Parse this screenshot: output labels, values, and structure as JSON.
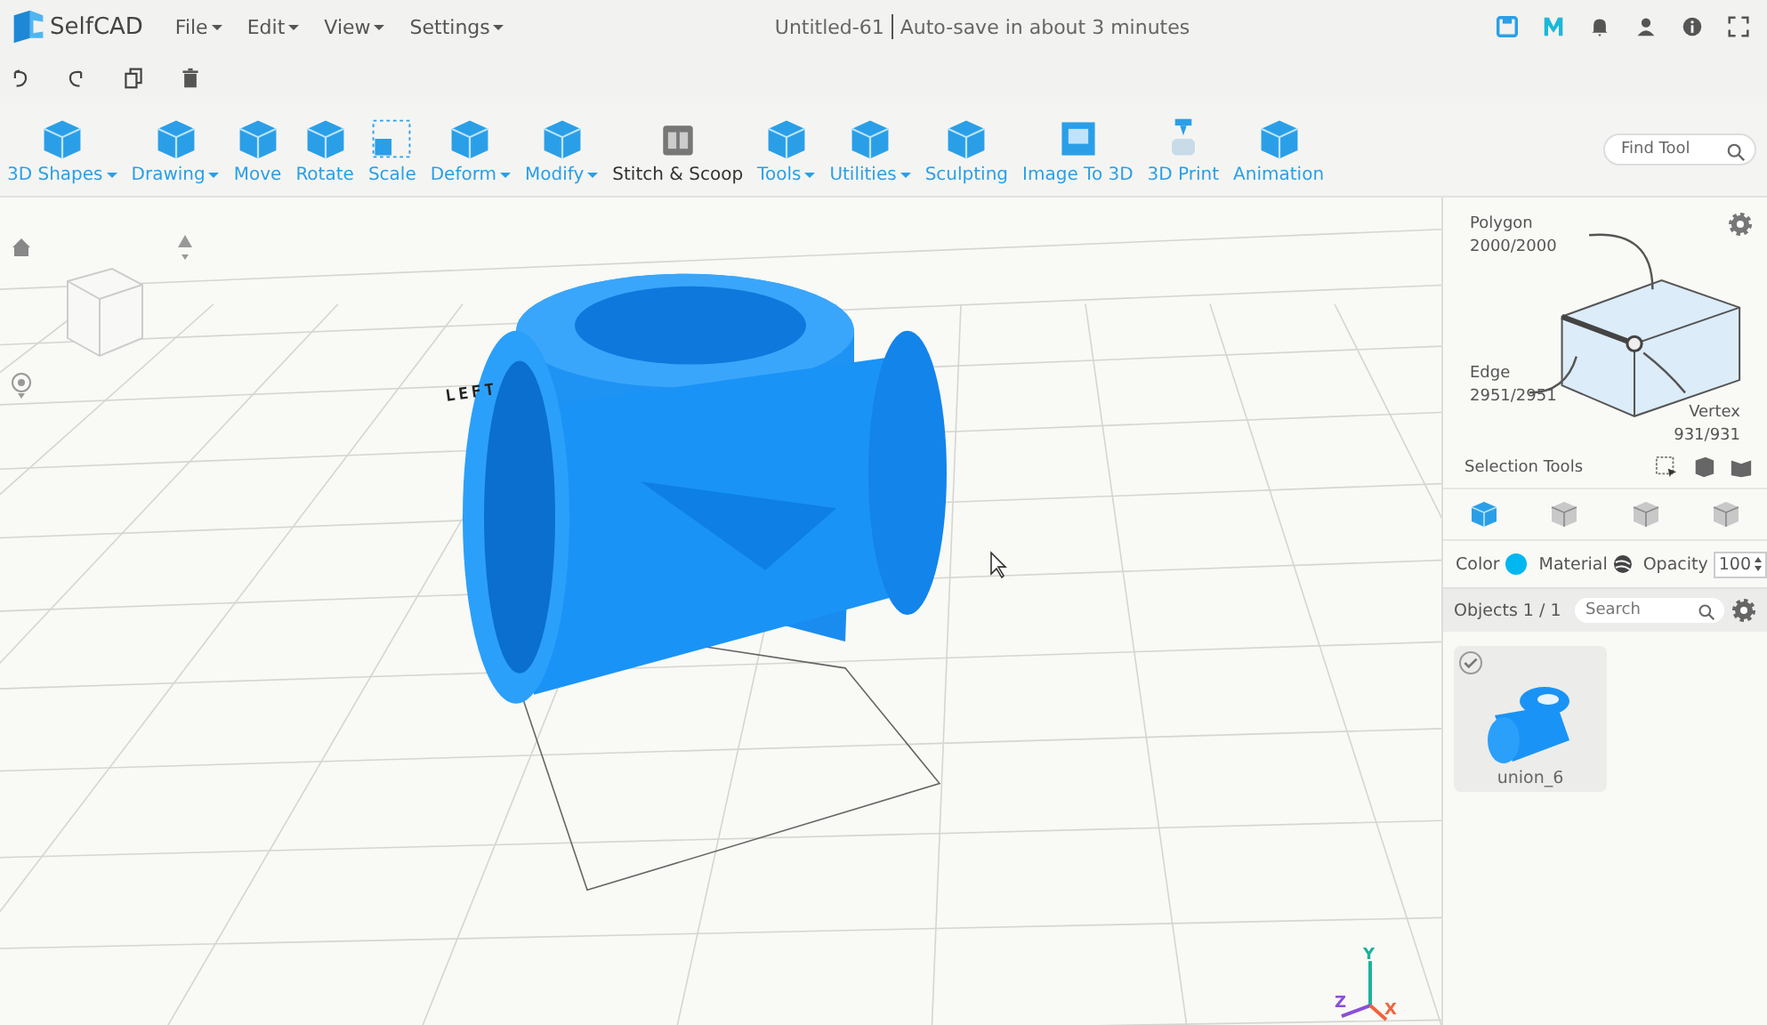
{
  "app": {
    "name": "SelfCAD"
  },
  "menu": [
    {
      "label": "File",
      "dropdown": true
    },
    {
      "label": "Edit",
      "dropdown": true
    },
    {
      "label": "View",
      "dropdown": true
    },
    {
      "label": "Settings",
      "dropdown": true
    }
  ],
  "document": {
    "title": "Untitled-61",
    "autosave": "Auto-save in about 3 minutes"
  },
  "toolbar": [
    {
      "label": "3D Shapes",
      "dropdown": true
    },
    {
      "label": "Drawing",
      "dropdown": true
    },
    {
      "label": "Move",
      "dropdown": false
    },
    {
      "label": "Rotate",
      "dropdown": false
    },
    {
      "label": "Scale",
      "dropdown": false
    },
    {
      "label": "Deform",
      "dropdown": true
    },
    {
      "label": "Modify",
      "dropdown": true
    },
    {
      "label": "Stitch & Scoop",
      "dropdown": false
    },
    {
      "label": "Tools",
      "dropdown": true
    },
    {
      "label": "Utilities",
      "dropdown": true
    },
    {
      "label": "Sculpting",
      "dropdown": false
    },
    {
      "label": "Image To 3D",
      "dropdown": false
    },
    {
      "label": "3D Print",
      "dropdown": false
    },
    {
      "label": "Animation",
      "dropdown": false
    }
  ],
  "find_tool": {
    "placeholder": "Find Tool"
  },
  "viewport": {
    "view_label": "LEFT",
    "axes": [
      "Y",
      "Z",
      "X"
    ]
  },
  "selection": {
    "polygon": {
      "label": "Polygon",
      "count": "2000/2000"
    },
    "edge": {
      "label": "Edge",
      "count": "2951/2951"
    },
    "vertex": {
      "label": "Vertex",
      "count": "931/931"
    },
    "tools_label": "Selection Tools"
  },
  "modes": [
    {
      "selected": true
    },
    {
      "selected": false
    },
    {
      "selected": false
    },
    {
      "selected": false
    }
  ],
  "properties": {
    "color_label": "Color",
    "color": "#00b7f0",
    "material_label": "Material",
    "opacity_label": "Opacity",
    "opacity": "100"
  },
  "objects": {
    "heading": "Objects 1 / 1",
    "search_placeholder": "Search",
    "items": [
      {
        "name": "union_6",
        "checked": true
      }
    ]
  }
}
